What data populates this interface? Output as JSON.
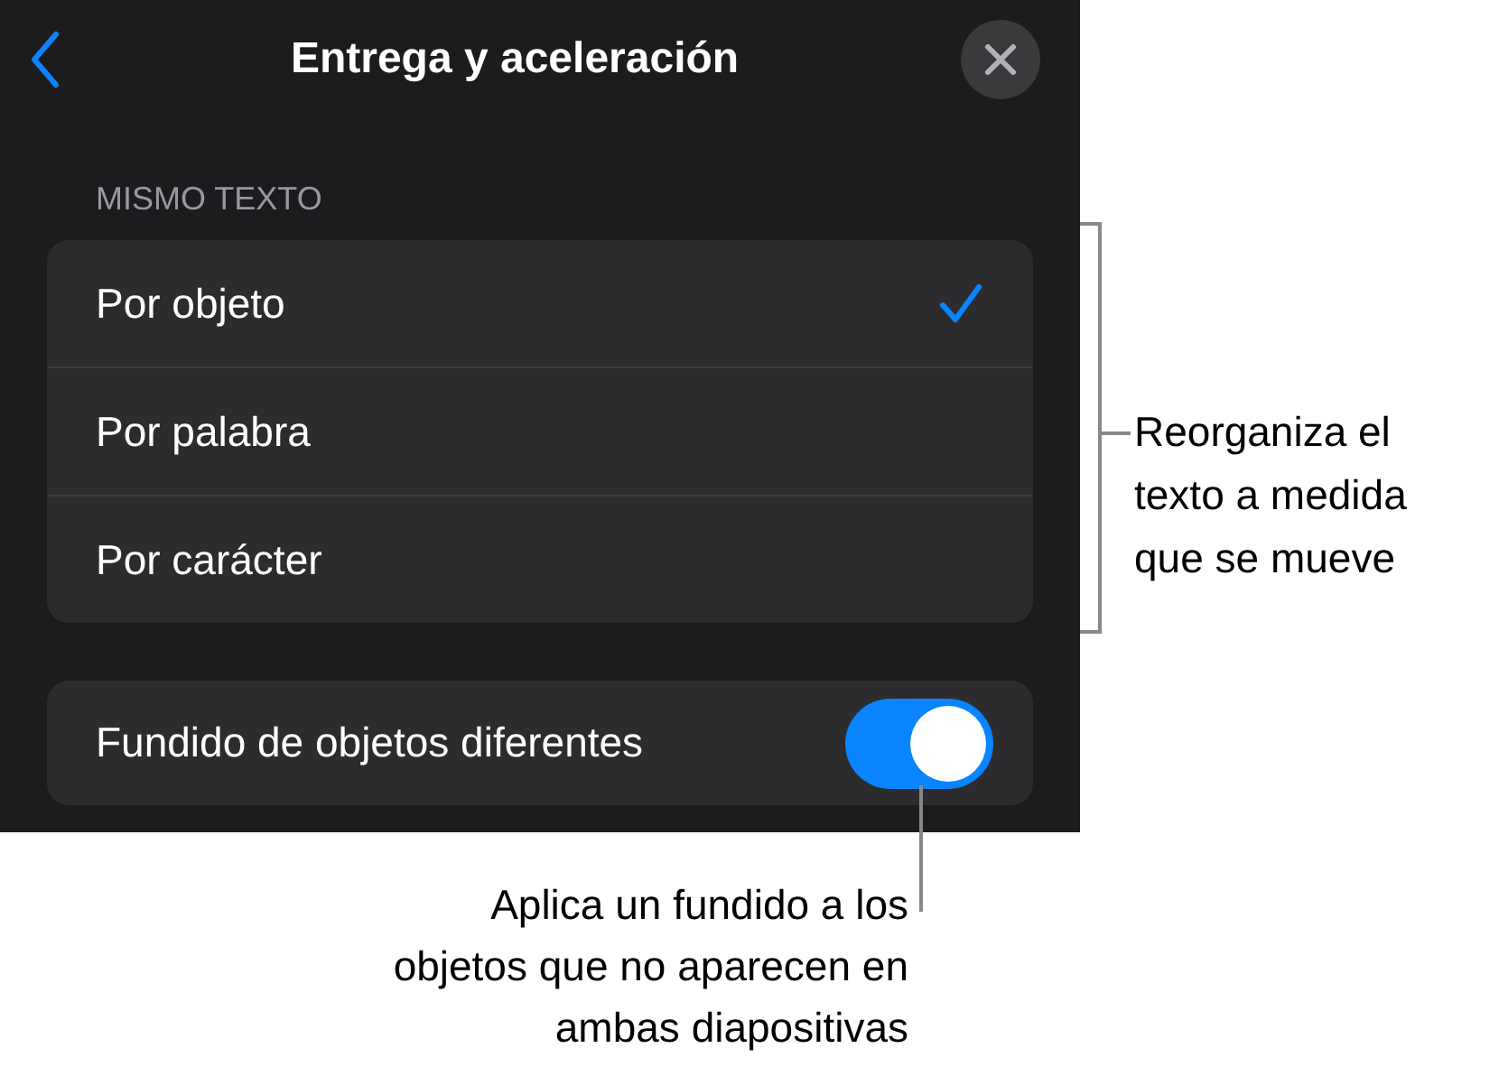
{
  "header": {
    "title": "Entrega y aceleración"
  },
  "section_label": "MISMO TEXTO",
  "options": [
    {
      "label": "Por objeto",
      "selected": true
    },
    {
      "label": "Por palabra",
      "selected": false
    },
    {
      "label": "Por carácter",
      "selected": false
    }
  ],
  "toggle_row": {
    "label": "Fundido de objetos diferentes",
    "on": true
  },
  "callouts": [
    {
      "kind": "bracket",
      "text": "Reorganiza el\ntexto a medida\nque se mueve"
    },
    {
      "kind": "pointer",
      "text": "Aplica un fundido a los\nobjetos que no aparecen en\nambas diapositivas"
    }
  ]
}
